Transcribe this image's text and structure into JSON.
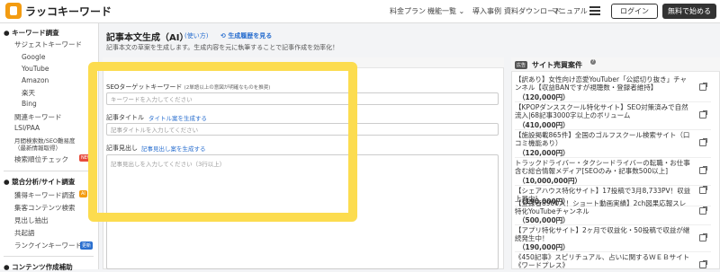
{
  "header": {
    "logo": "ラッコキーワード",
    "nav": [
      "料金プラン",
      "機能一覧 ⌄",
      "導入事例",
      "資料ダウンロード",
      "マニュアル"
    ],
    "login": "ログイン",
    "trial": "無料で始める"
  },
  "sidebar": {
    "keyword_section": "キーワード調査",
    "keyword_items": [
      "サジェストキーワード",
      "Google",
      "YouTube",
      "Amazon",
      "楽天",
      "Bing",
      "関連キーワード",
      "LSI/PAA",
      "月間検索数/SEO難易度",
      "（最新情報取得）",
      "検索順位チェック"
    ],
    "badge_new": "NEW",
    "competitor_section": "競合分析/サイト調査",
    "competitor_items": [
      "獲得キーワード調査",
      "集客コンテンツ検索",
      "見出し抽出",
      "共起語",
      "ランクインキーワード"
    ],
    "badge_ai": "AI",
    "badge_update": "更新",
    "content_section": "コンテンツ作成補助"
  },
  "main": {
    "title": "記事本文生成（AI）",
    "usage_link": "使い方",
    "history_link": "生成履歴を見る",
    "description": "記事本文の草案を生成します。生成内容を元に執筆することで記事作成を効率化！",
    "seo_label": "SEOターゲットキーワード",
    "seo_note": "(2単語以上の意図が明確なものを推奨)",
    "seo_placeholder": "キーワードを入力してください",
    "title_label": "記事タイトル",
    "title_gen": "タイトル案を生成する",
    "title_placeholder": "記事タイトルを入力してください",
    "heading_label": "記事見出し",
    "heading_gen": "記事見出し案を生成する",
    "heading_placeholder": "記事見出しを入力してください（3行以上）"
  },
  "right_panel": {
    "badge": "広告",
    "title": "サイト売買案件",
    "help": "?",
    "items": [
      {
        "title": "【訳あり】女性向け恋愛YouTuber「公認切り抜き」チャンネル【収益BANですが視聴数・登録者維持】",
        "price": "（120,000円）"
      },
      {
        "title": "【KPOPダンススクール特化サイト】SEO対策済みで自然流入|68記事3000字以上のボリューム",
        "price": "（410,000円）"
      },
      {
        "title": "【施設掲載865件】全国のゴルフスクール検索サイト（口コミ機能あり）",
        "price": "（120,000円）"
      },
      {
        "title": "トラックドライバー・タクシードライバーの転職・お仕事含む総合情報メディア[SEOのみ・記事数500以上]",
        "price": "（10,000,000円）"
      },
      {
        "title": "【シェアハウス特化サイト】17投稿で3月8,733PV！収益上昇中!",
        "price": "（190,000円）"
      },
      {
        "title": "【登録者8900人！ショート動画実績】2ch図果応報スレ特化YouTubeチャンネル",
        "price": "（500,000円）"
      },
      {
        "title": "【アプリ特化サイト】2ヶ月で収益化・50投稿で収益が継続発生中！",
        "price": "（190,000円）"
      },
      {
        "title": "《450記事》スピリチュアル、占いに関するＷＥＢサイト《ワードプレス》",
        "price": ""
      }
    ]
  },
  "colors": {
    "highlight": "#fcdc4f",
    "link": "#2a6fcf",
    "new_badge": "#e74c3c",
    "ai_badge": "#f39c12",
    "update_badge": "#2a6fcf"
  }
}
